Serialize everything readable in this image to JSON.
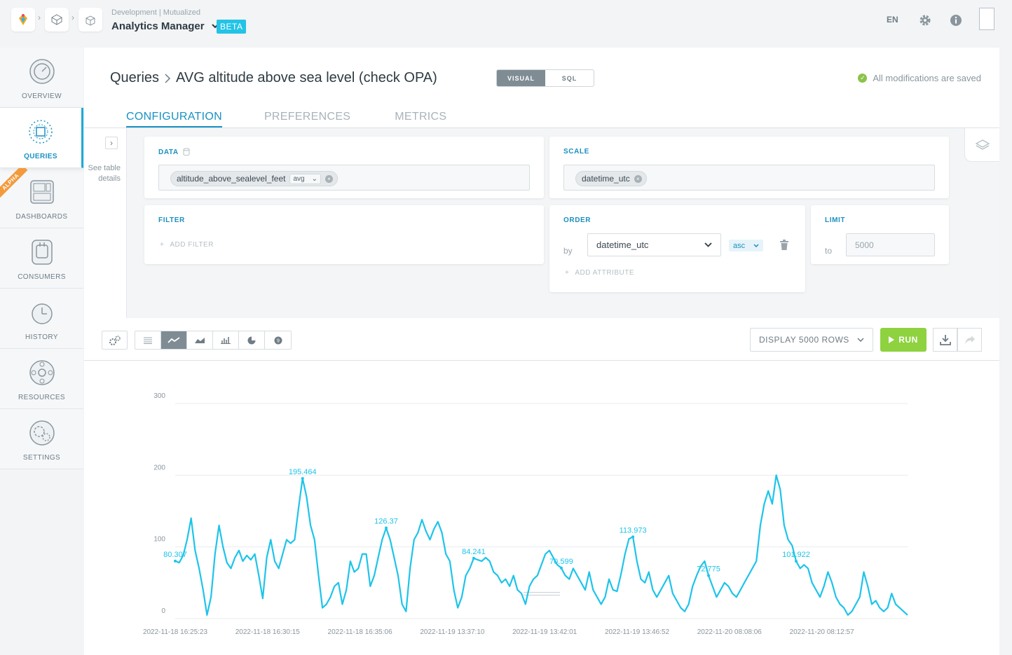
{
  "header": {
    "context": "Development | Mutualized",
    "app_name": "Analytics Manager",
    "badge": "BETA",
    "language": "EN"
  },
  "nav": [
    {
      "label": "OVERVIEW",
      "icon": "overview-icon"
    },
    {
      "label": "QUERIES",
      "icon": "queries-icon",
      "active": true
    },
    {
      "label": "DASHBOARDS",
      "icon": "dashboards-icon",
      "tag": "ALPHA"
    },
    {
      "label": "CONSUMERS",
      "icon": "consumers-icon"
    },
    {
      "label": "HISTORY",
      "icon": "history-icon"
    },
    {
      "label": "RESOURCES",
      "icon": "resources-icon"
    },
    {
      "label": "SETTINGS",
      "icon": "settings-icon"
    }
  ],
  "page": {
    "breadcrumb_root": "Queries",
    "query_name": "AVG altitude above sea level (check OPA)",
    "mode_visual": "VISUAL",
    "mode_sql": "SQL",
    "save_status": "All modifications are saved"
  },
  "tabs": [
    "CONFIGURATION",
    "PREFERENCES",
    "METRICS"
  ],
  "side_panel": {
    "label": "See table details"
  },
  "config": {
    "data_title": "DATA",
    "data_field": "altitude_above_sealevel_feet",
    "data_agg": "avg",
    "scale_title": "SCALE",
    "scale_field": "datetime_utc",
    "filter_title": "FILTER",
    "add_filter": "ADD FILTER",
    "order_title": "ORDER",
    "order_by_label": "by",
    "order_field": "datetime_utc",
    "order_dir": "asc",
    "add_attribute": "ADD ATTRIBUTE",
    "limit_title": "LIMIT",
    "limit_to_label": "to",
    "limit_placeholder": "5000"
  },
  "toolbar": {
    "display_rows": "DISPLAY 5000 ROWS",
    "run": "RUN"
  },
  "colors": {
    "accent": "#1992c4",
    "series": "#1dc4ea",
    "run": "#8ed23f"
  },
  "chart_data": {
    "type": "line",
    "ylim": [
      0,
      300
    ],
    "yticks": [
      "0",
      "100",
      "200",
      "300"
    ],
    "xticks": [
      "2022-11-18 16:25:23",
      "2022-11-18 16:30:15",
      "2022-11-18 16:35:06",
      "2022-11-19 13:37:10",
      "2022-11-19 13:42:01",
      "2022-11-19 13:46:52",
      "2022-11-20 08:08:06",
      "2022-11-20 08:12:57"
    ],
    "values": [
      80.3,
      78,
      88,
      110,
      140,
      95,
      70,
      40,
      5,
      30,
      90,
      130,
      100,
      78,
      70,
      85,
      95,
      80,
      88,
      82,
      90,
      60,
      28,
      85,
      110,
      80,
      70,
      90,
      110,
      105,
      110,
      155,
      195.5,
      170,
      130,
      110,
      60,
      15,
      20,
      30,
      45,
      50,
      20,
      40,
      80,
      65,
      70,
      90,
      90,
      45,
      60,
      85,
      110,
      126.4,
      110,
      85,
      60,
      20,
      10,
      70,
      110,
      120,
      138,
      122,
      110,
      125,
      135,
      120,
      90,
      80,
      40,
      15,
      30,
      60,
      70,
      84.2,
      82,
      80,
      85,
      80,
      65,
      60,
      50,
      55,
      45,
      60,
      40,
      35,
      20,
      45,
      55,
      60,
      75,
      90,
      95,
      85,
      75,
      70.6,
      60,
      55,
      70,
      60,
      50,
      40,
      65,
      40,
      30,
      20,
      30,
      55,
      40,
      38,
      62,
      90,
      111,
      114,
      80,
      55,
      50,
      65,
      40,
      30,
      40,
      50,
      60,
      35,
      25,
      15,
      10,
      20,
      45,
      60,
      72.8,
      80,
      60,
      45,
      30,
      40,
      50,
      45,
      35,
      30,
      40,
      50,
      60,
      70,
      80,
      130,
      160,
      178,
      160,
      200,
      180,
      130,
      110,
      101.9,
      80,
      70,
      75,
      70,
      50,
      40,
      30,
      45,
      65,
      50,
      30,
      20,
      15,
      5,
      10,
      20,
      30,
      65,
      45,
      20,
      25,
      15,
      10,
      15,
      35,
      20,
      15,
      10,
      5
    ],
    "annotations": [
      {
        "index": 0,
        "label": "80.307"
      },
      {
        "index": 32,
        "label": "195.464"
      },
      {
        "index": 53,
        "label": "126.37"
      },
      {
        "index": 75,
        "label": "84.241"
      },
      {
        "index": 97,
        "label": "70.599"
      },
      {
        "index": 115,
        "label": "113.973"
      },
      {
        "index": 134,
        "label": "72.775"
      },
      {
        "index": 156,
        "label": "101.922"
      }
    ]
  }
}
